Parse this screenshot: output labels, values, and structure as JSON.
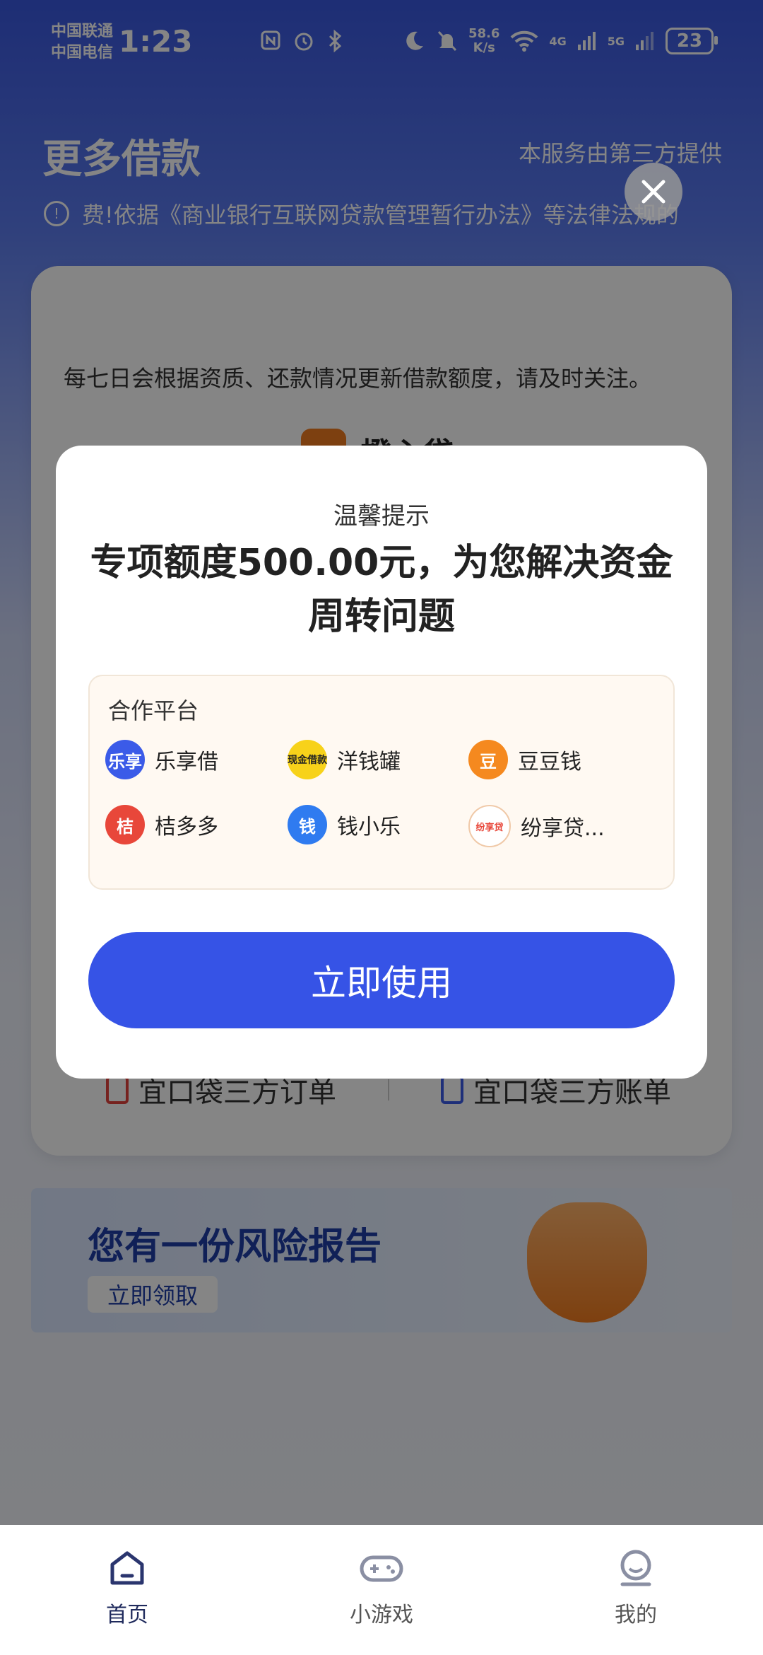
{
  "status_bar": {
    "carrier_1": "中国联通",
    "carrier_2": "中国电信",
    "time": "1:23",
    "net_speed_value": "58.6",
    "net_speed_unit": "K/s",
    "signal_1": "4G",
    "signal_2": "5G",
    "battery": "23"
  },
  "header": {
    "title": "更多借款",
    "provider_note": "本服务由第三方提供",
    "notice": "费!依据《商业银行互联网贷款管理暂行办法》等法律法规的"
  },
  "card": {
    "info_text": "每七日会根据资质、还款情况更新借款额度，请及时关注。",
    "brand_name": "橙心贷",
    "order_link": "宜口袋三方订单",
    "bill_link": "宜口袋三方账单"
  },
  "risk_banner": {
    "title": "您有一份风险报告",
    "button": "立即领取"
  },
  "dialog": {
    "subtitle": "温馨提示",
    "title": "专项额度500.00元，为您解决资金周转问题",
    "partners_label": "合作平台",
    "partners": [
      {
        "name": "乐享借",
        "logo_text": "乐享",
        "color": "#3b5be8"
      },
      {
        "name": "洋钱罐",
        "logo_text": "现金借款",
        "color": "#f7d21a"
      },
      {
        "name": "豆豆钱",
        "logo_text": "豆",
        "color": "#f5891f"
      },
      {
        "name": "桔多多",
        "logo_text": "桔",
        "color": "#e8473a"
      },
      {
        "name": "钱小乐",
        "logo_text": "钱",
        "color": "#2f7bf0"
      },
      {
        "name": "纷享贷...",
        "logo_text": "纷享贷",
        "color": "#ffffff"
      }
    ],
    "use_button": "立即使用"
  },
  "bottom_nav": {
    "home": "首页",
    "games": "小游戏",
    "mine": "我的"
  },
  "colors": {
    "accent": "#3653e6",
    "header_gradient_top": "#3a58e0"
  }
}
